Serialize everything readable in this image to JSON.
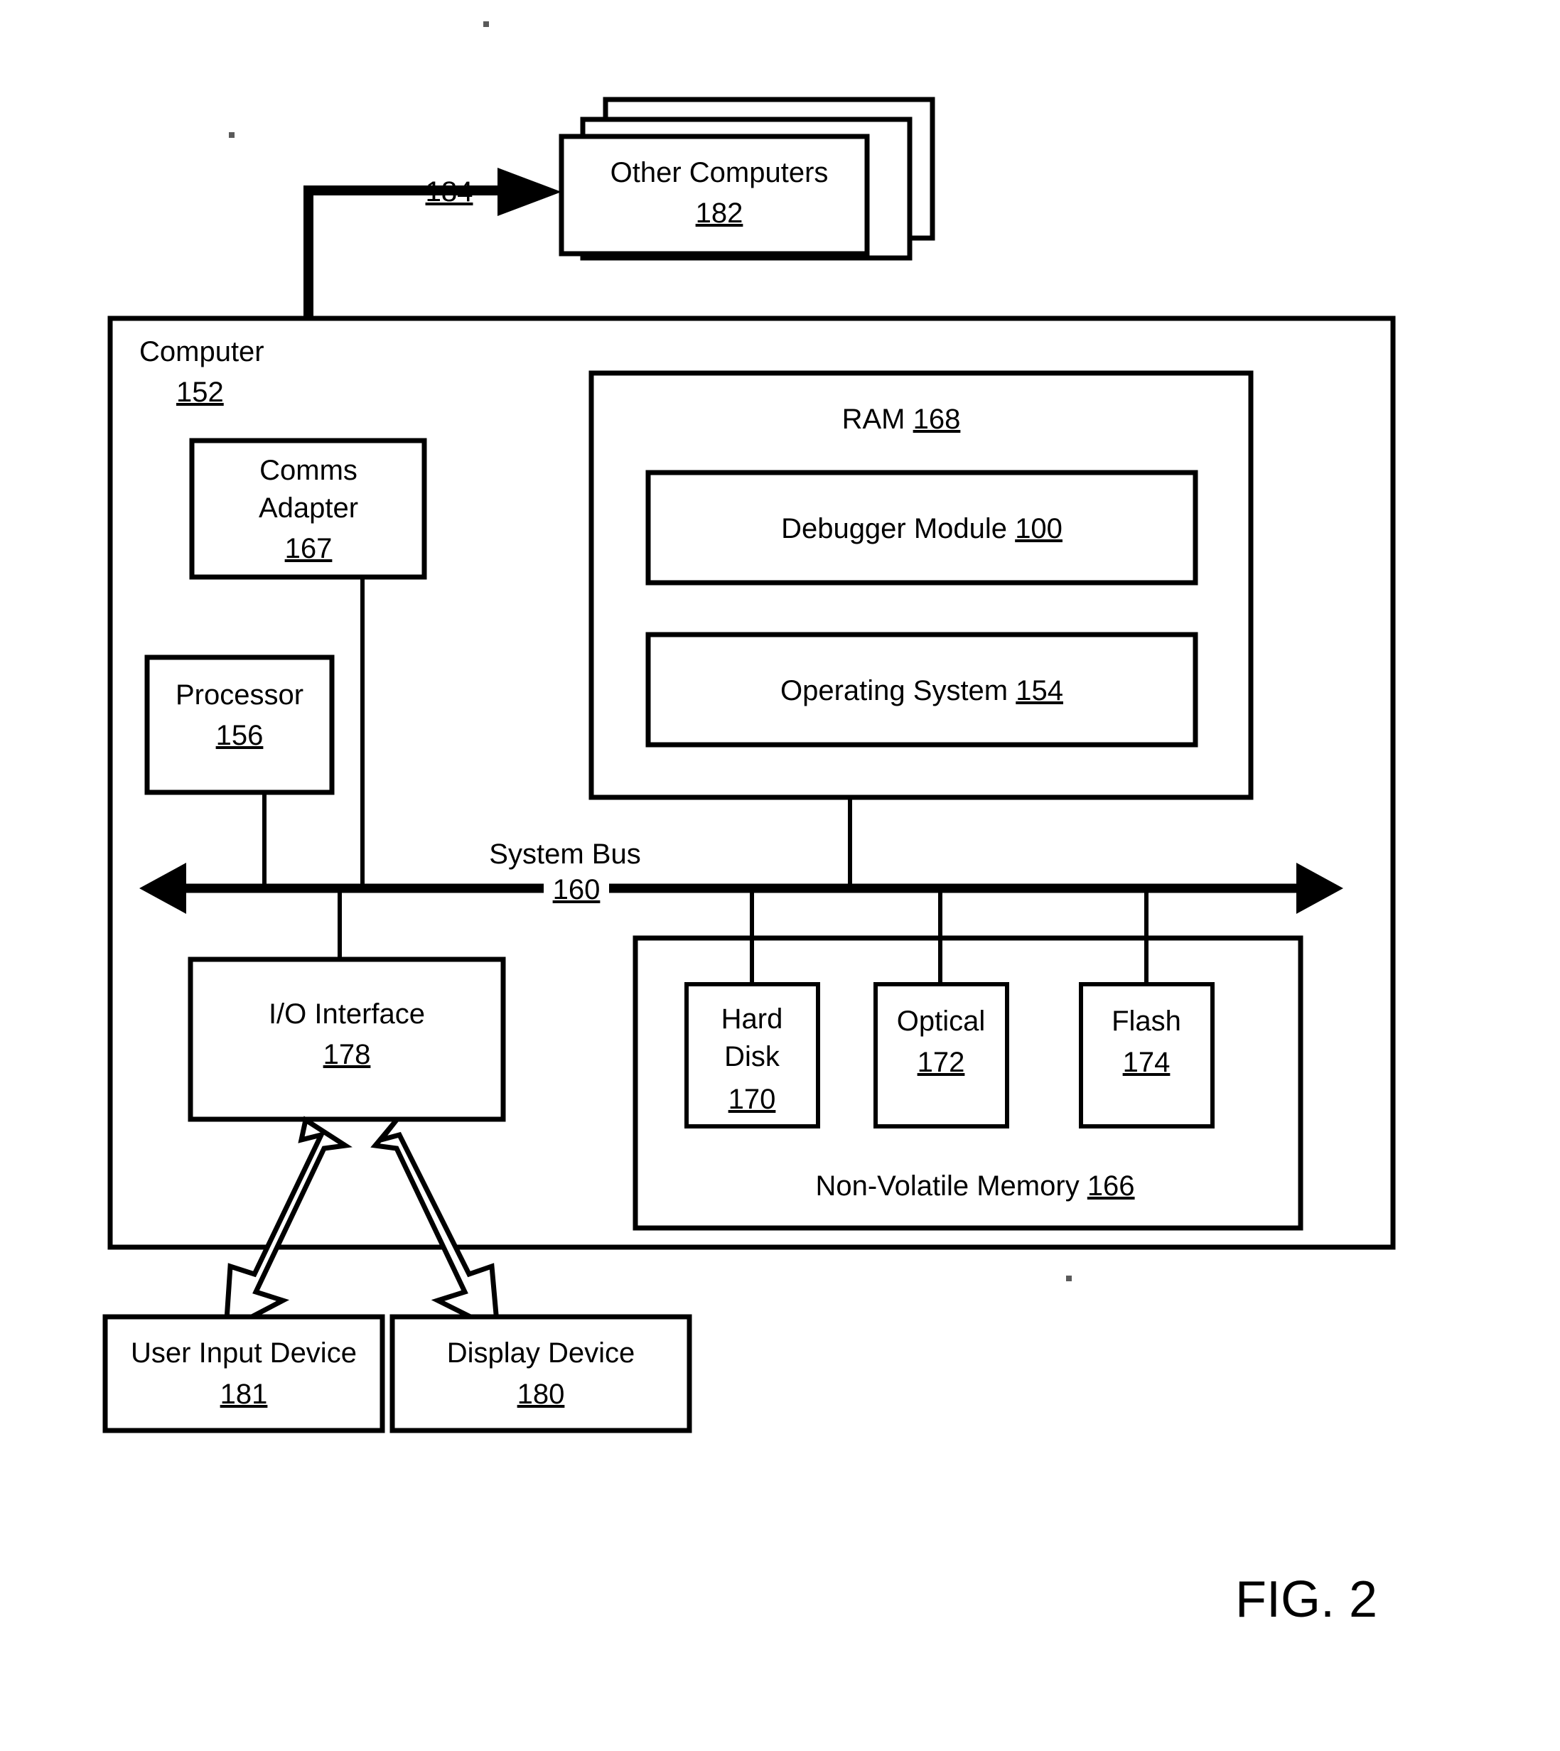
{
  "figure": {
    "caption": "FIG. 2"
  },
  "nodes": {
    "other_computers": {
      "title": "Other Computers",
      "ref": "182"
    },
    "computer": {
      "title": "Computer",
      "ref": "152"
    },
    "comms_adapter": {
      "line1": "Comms",
      "line2": "Adapter",
      "ref": "167"
    },
    "processor": {
      "title": "Processor",
      "ref": "156"
    },
    "ram": {
      "title": "RAM",
      "ref": "168"
    },
    "debugger_module": {
      "title": "Debugger Module",
      "ref": "100"
    },
    "operating_system": {
      "title": "Operating System",
      "ref": "154"
    },
    "system_bus": {
      "title": "System Bus",
      "ref": "160"
    },
    "io_interface": {
      "title": "I/O Interface",
      "ref": "178"
    },
    "non_volatile_memory": {
      "title": "Non-Volatile Memory",
      "ref": "166"
    },
    "hard_disk": {
      "line1": "Hard",
      "line2": "Disk",
      "ref": "170"
    },
    "optical": {
      "title": "Optical",
      "ref": "172"
    },
    "flash": {
      "title": "Flash",
      "ref": "174"
    },
    "user_input_device": {
      "title": "User Input Device",
      "ref": "181"
    },
    "display_device": {
      "title": "Display Device",
      "ref": "180"
    }
  },
  "connectors": {
    "network_link": {
      "ref": "184"
    }
  },
  "colors": {
    "line": "#000000",
    "fill": "#ffffff",
    "background": "#ffffff"
  }
}
